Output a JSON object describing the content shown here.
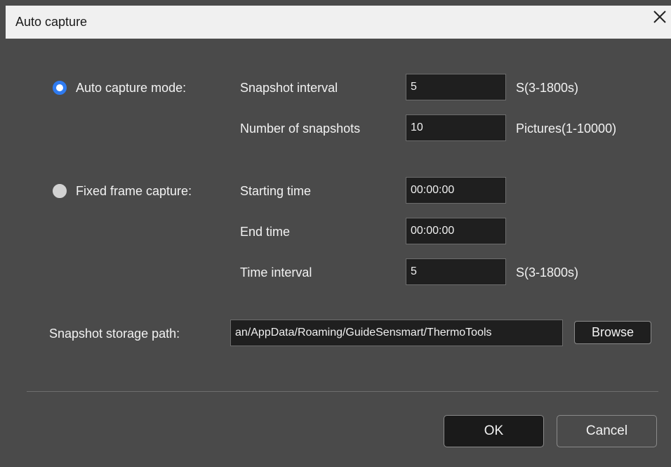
{
  "dialog": {
    "title": "Auto capture",
    "close_icon": "close-icon"
  },
  "auto_mode": {
    "label": "Auto capture mode:",
    "selected": true,
    "snapshot_interval_label": "Snapshot interval",
    "snapshot_interval_value": "5",
    "snapshot_interval_range": "S(3-1800s)",
    "num_snapshots_label": "Number of snapshots",
    "num_snapshots_value": "10",
    "num_snapshots_range": "Pictures(1-10000)"
  },
  "fixed_mode": {
    "label": "Fixed frame capture:",
    "selected": false,
    "start_label": "Starting time",
    "start_value": "00:00:00",
    "end_label": "End time",
    "end_value": "00:00:00",
    "interval_label": "Time interval",
    "interval_value": "5",
    "interval_range": "S(3-1800s)"
  },
  "storage": {
    "label": "Snapshot storage path:",
    "path": "an/AppData/Roaming/GuideSensmart/ThermoTools",
    "browse_label": "Browse"
  },
  "buttons": {
    "ok": "OK",
    "cancel": "Cancel"
  },
  "colors": {
    "accent": "#2f7bf0",
    "background": "#4a4a4a",
    "titlebar": "#f0f0f0"
  }
}
